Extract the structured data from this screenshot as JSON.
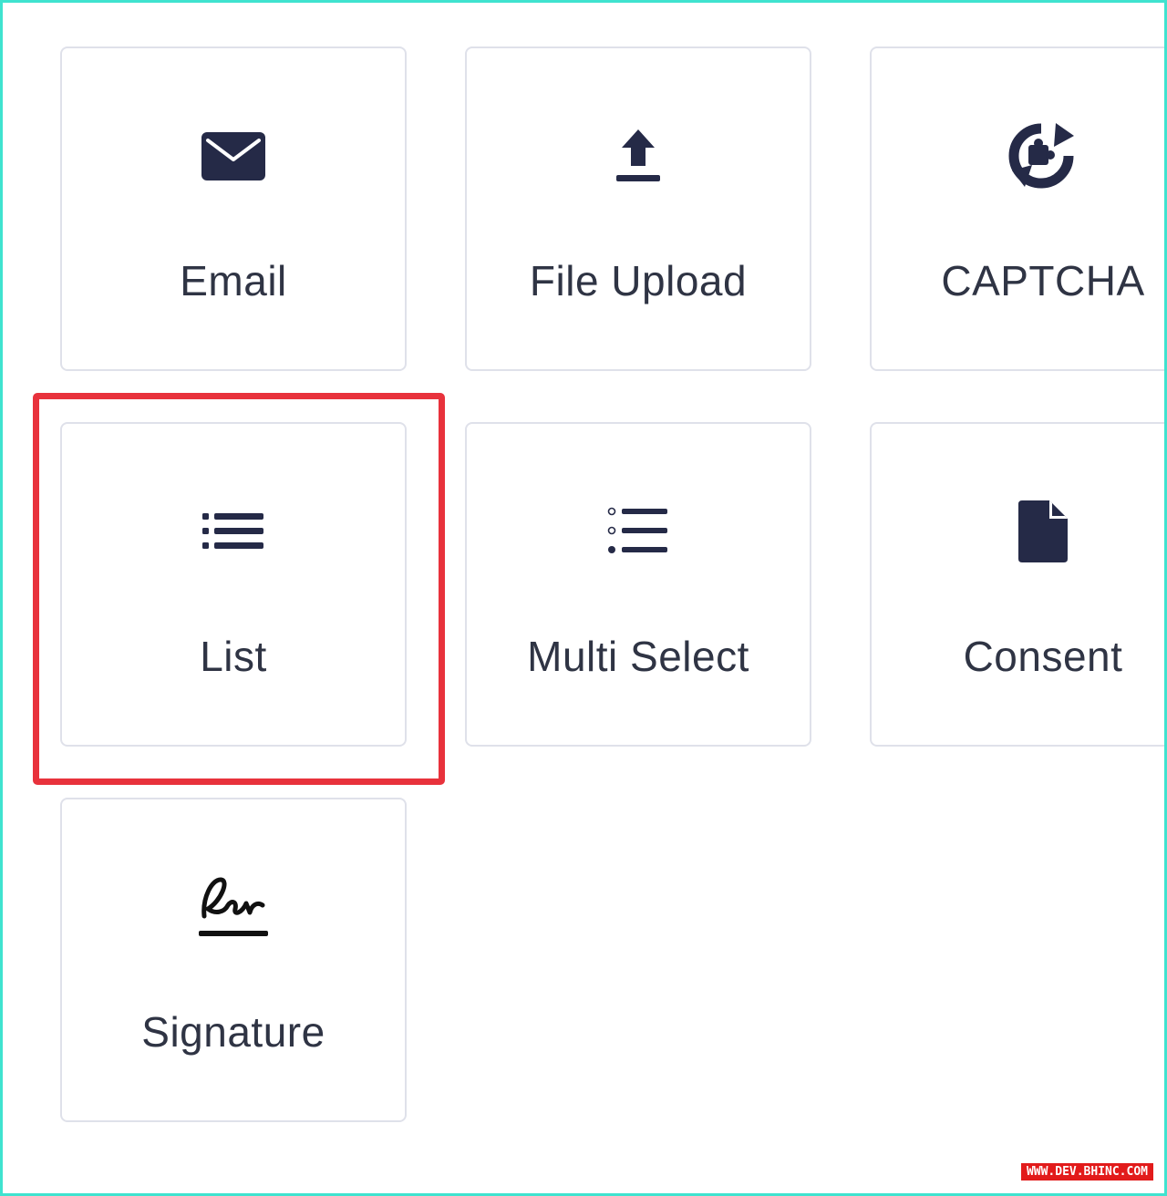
{
  "colors": {
    "icon": "#252a47",
    "label": "#2f3444",
    "tile_border": "#dfe1ea",
    "highlight": "#e8323c",
    "frame": "#3fe3cf"
  },
  "fields": [
    {
      "label": "Email",
      "icon": "envelope-icon"
    },
    {
      "label": "File Upload",
      "icon": "upload-icon"
    },
    {
      "label": "CAPTCHA",
      "icon": "refresh-puzzle-icon"
    },
    {
      "label": "List",
      "icon": "list-icon",
      "highlighted": true
    },
    {
      "label": "Multi Select",
      "icon": "checklist-icon"
    },
    {
      "label": "Consent",
      "icon": "document-icon"
    },
    {
      "label": "Signature",
      "icon": "signature-icon"
    }
  ],
  "watermark": "WWW.DEV.BHINC.COM"
}
